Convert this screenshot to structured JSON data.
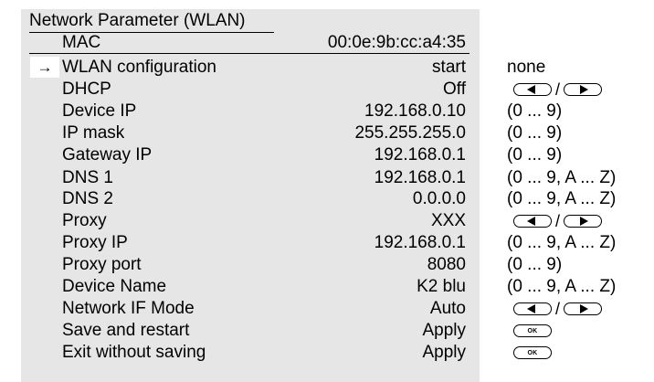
{
  "title": "Network Parameter (WLAN)",
  "selected_index": 1,
  "rows": [
    {
      "label": "MAC",
      "value": "00:0e:9b:cc:a4:35",
      "hint": "",
      "control": "none"
    },
    {
      "label": "WLAN configuration",
      "value": "start",
      "hint": "none",
      "control": "text"
    },
    {
      "label": "DHCP",
      "value": "Off",
      "hint": "",
      "control": "arrows"
    },
    {
      "label": "Device IP",
      "value": "192.168.0.10",
      "hint": "(0 ... 9)",
      "control": "text"
    },
    {
      "label": "IP mask",
      "value": "255.255.255.0",
      "hint": "(0 ... 9)",
      "control": "text"
    },
    {
      "label": "Gateway IP",
      "value": "192.168.0.1",
      "hint": "(0 ... 9)",
      "control": "text"
    },
    {
      "label": "DNS 1",
      "value": "192.168.0.1",
      "hint": "(0 ... 9, A ... Z)",
      "control": "text"
    },
    {
      "label": "DNS 2",
      "value": "0.0.0.0",
      "hint": "(0 ... 9, A ... Z)",
      "control": "text"
    },
    {
      "label": "Proxy",
      "value": "XXX",
      "hint": "",
      "control": "arrows"
    },
    {
      "label": "Proxy IP",
      "value": "192.168.0.1",
      "hint": "(0 ... 9, A ... Z)",
      "control": "text"
    },
    {
      "label": "Proxy port",
      "value": "8080",
      "hint": "(0 ... 9)",
      "control": "text"
    },
    {
      "label": "Device Name",
      "value": "K2 blu",
      "hint": "(0 ... 9, A ... Z)",
      "control": "text"
    },
    {
      "label": "Network IF Mode",
      "value": "Auto",
      "hint": "",
      "control": "arrows"
    },
    {
      "label": "Save and restart",
      "value": "Apply",
      "hint": "",
      "control": "ok"
    },
    {
      "label": "Exit without saving",
      "value": "Apply",
      "hint": "",
      "control": "ok"
    }
  ],
  "arrow_separator": "/",
  "ok_label": "OK",
  "selection_arrow": "→",
  "colors": {
    "panel": "#e6e6e6",
    "selection": "#ffffff"
  }
}
